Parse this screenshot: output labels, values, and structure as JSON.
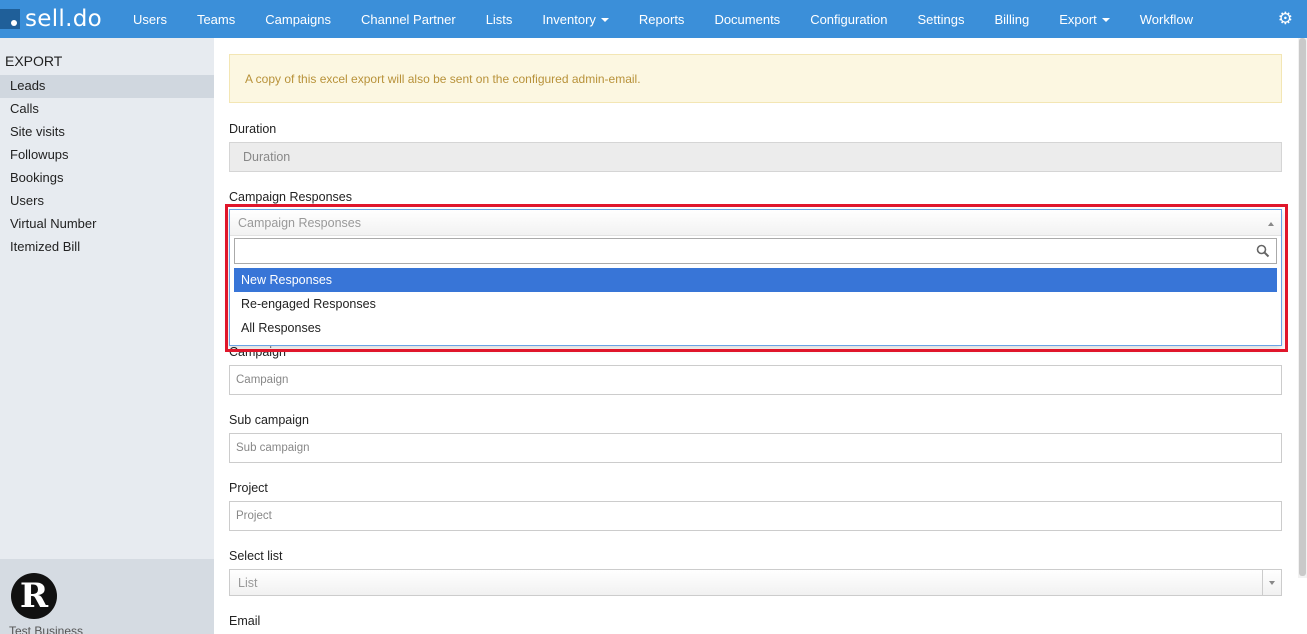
{
  "brand": {
    "name": "sell.do"
  },
  "nav": {
    "items": [
      {
        "label": "Users",
        "dropdown": false
      },
      {
        "label": "Teams",
        "dropdown": false
      },
      {
        "label": "Campaigns",
        "dropdown": false
      },
      {
        "label": "Channel Partner",
        "dropdown": false
      },
      {
        "label": "Lists",
        "dropdown": false
      },
      {
        "label": "Inventory",
        "dropdown": true
      },
      {
        "label": "Reports",
        "dropdown": false
      },
      {
        "label": "Documents",
        "dropdown": false
      },
      {
        "label": "Configuration",
        "dropdown": false
      },
      {
        "label": "Settings",
        "dropdown": false
      },
      {
        "label": "Billing",
        "dropdown": false
      },
      {
        "label": "Export",
        "dropdown": true
      },
      {
        "label": "Workflow",
        "dropdown": false
      }
    ],
    "settings_icon": "gear-icon"
  },
  "sidebar": {
    "title": "EXPORT",
    "items": [
      {
        "label": "Leads",
        "active": true
      },
      {
        "label": "Calls",
        "active": false
      },
      {
        "label": "Site visits",
        "active": false
      },
      {
        "label": "Followups",
        "active": false
      },
      {
        "label": "Bookings",
        "active": false
      },
      {
        "label": "Users",
        "active": false
      },
      {
        "label": "Virtual Number",
        "active": false
      },
      {
        "label": "Itemized Bill",
        "active": false
      }
    ],
    "footer": {
      "avatar_letter": "R",
      "business_name": "Test Business"
    }
  },
  "main": {
    "alert": "A copy of this excel export will also be sent on the configured admin-email.",
    "duration": {
      "label": "Duration",
      "placeholder": "Duration"
    },
    "campaign_responses": {
      "label": "Campaign Responses",
      "placeholder": "Campaign Responses",
      "options": [
        "New Responses",
        "Re-engaged Responses",
        "All Responses"
      ],
      "highlighted_option": "New Responses"
    },
    "campaign": {
      "label": "Campaign",
      "placeholder": "Campaign"
    },
    "sub_campaign": {
      "label": "Sub campaign",
      "placeholder": "Sub campaign"
    },
    "project": {
      "label": "Project",
      "placeholder": "Project"
    },
    "select_list": {
      "label": "Select list",
      "placeholder": "List"
    },
    "email": {
      "label": "Email"
    }
  },
  "colors": {
    "navbar": "#3b8fd9",
    "highlight": "#e0162b",
    "option_selected": "#3875d7"
  }
}
